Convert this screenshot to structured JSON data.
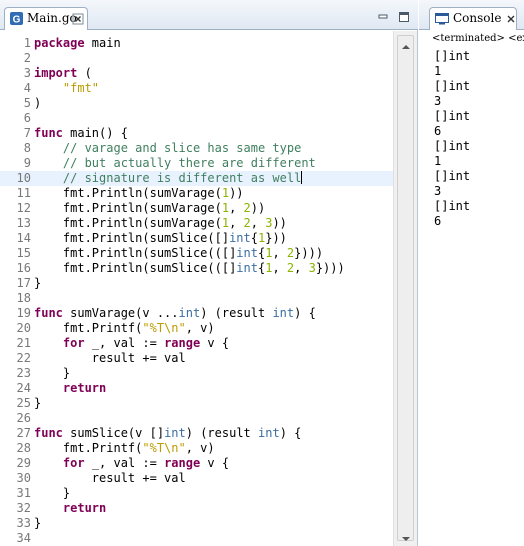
{
  "editor": {
    "tab_label": "Main.go",
    "lines": [
      {
        "n": "1",
        "tokens": [
          {
            "t": "kw",
            "v": "package"
          },
          {
            "t": "",
            "v": " main"
          }
        ]
      },
      {
        "n": "2",
        "tokens": []
      },
      {
        "n": "3",
        "tokens": [
          {
            "t": "kw",
            "v": "import"
          },
          {
            "t": "",
            "v": " ("
          }
        ]
      },
      {
        "n": "4",
        "tokens": [
          {
            "t": "",
            "v": "    "
          },
          {
            "t": "str",
            "v": "\"fmt\""
          }
        ]
      },
      {
        "n": "5",
        "tokens": [
          {
            "t": "",
            "v": ")"
          }
        ]
      },
      {
        "n": "6",
        "tokens": []
      },
      {
        "n": "7",
        "tokens": [
          {
            "t": "kw",
            "v": "func"
          },
          {
            "t": "",
            "v": " main() {"
          }
        ]
      },
      {
        "n": "8",
        "tokens": [
          {
            "t": "",
            "v": "    "
          },
          {
            "t": "cm",
            "v": "// varage and slice has same type"
          }
        ]
      },
      {
        "n": "9",
        "tokens": [
          {
            "t": "",
            "v": "    "
          },
          {
            "t": "cm",
            "v": "// but actually there are different"
          }
        ]
      },
      {
        "n": "10",
        "current": true,
        "tokens": [
          {
            "t": "",
            "v": "    "
          },
          {
            "t": "cm",
            "v": "// signature is different as well"
          },
          {
            "t": "caret",
            "v": ""
          }
        ]
      },
      {
        "n": "11",
        "tokens": [
          {
            "t": "",
            "v": "    fmt.Println(sumVarage("
          },
          {
            "t": "num",
            "v": "1"
          },
          {
            "t": "",
            "v": "))"
          }
        ]
      },
      {
        "n": "12",
        "tokens": [
          {
            "t": "",
            "v": "    fmt.Println(sumVarage("
          },
          {
            "t": "num",
            "v": "1"
          },
          {
            "t": "",
            "v": ", "
          },
          {
            "t": "num",
            "v": "2"
          },
          {
            "t": "",
            "v": "))"
          }
        ]
      },
      {
        "n": "13",
        "tokens": [
          {
            "t": "",
            "v": "    fmt.Println(sumVarage("
          },
          {
            "t": "num",
            "v": "1"
          },
          {
            "t": "",
            "v": ", "
          },
          {
            "t": "num",
            "v": "2"
          },
          {
            "t": "",
            "v": ", "
          },
          {
            "t": "num",
            "v": "3"
          },
          {
            "t": "",
            "v": "))"
          }
        ]
      },
      {
        "n": "14",
        "tokens": [
          {
            "t": "",
            "v": "    fmt.Println(sumSlice([]"
          },
          {
            "t": "ty",
            "v": "int"
          },
          {
            "t": "",
            "v": "{"
          },
          {
            "t": "num",
            "v": "1"
          },
          {
            "t": "",
            "v": "}))"
          }
        ]
      },
      {
        "n": "15",
        "tokens": [
          {
            "t": "",
            "v": "    fmt.Println(sumSlice(([]"
          },
          {
            "t": "ty",
            "v": "int"
          },
          {
            "t": "",
            "v": "{"
          },
          {
            "t": "num",
            "v": "1"
          },
          {
            "t": "",
            "v": ", "
          },
          {
            "t": "num",
            "v": "2"
          },
          {
            "t": "",
            "v": "})))"
          }
        ]
      },
      {
        "n": "16",
        "tokens": [
          {
            "t": "",
            "v": "    fmt.Println(sumSlice(([]"
          },
          {
            "t": "ty",
            "v": "int"
          },
          {
            "t": "",
            "v": "{"
          },
          {
            "t": "num",
            "v": "1"
          },
          {
            "t": "",
            "v": ", "
          },
          {
            "t": "num",
            "v": "2"
          },
          {
            "t": "",
            "v": ", "
          },
          {
            "t": "num",
            "v": "3"
          },
          {
            "t": "",
            "v": "})))"
          }
        ]
      },
      {
        "n": "17",
        "tokens": [
          {
            "t": "",
            "v": "}"
          }
        ]
      },
      {
        "n": "18",
        "tokens": []
      },
      {
        "n": "19",
        "tokens": [
          {
            "t": "kw",
            "v": "func"
          },
          {
            "t": "",
            "v": " sumVarage(v ..."
          },
          {
            "t": "ty",
            "v": "int"
          },
          {
            "t": "",
            "v": ") (result "
          },
          {
            "t": "ty",
            "v": "int"
          },
          {
            "t": "",
            "v": ") {"
          }
        ]
      },
      {
        "n": "20",
        "tokens": [
          {
            "t": "",
            "v": "    fmt.Printf("
          },
          {
            "t": "str",
            "v": "\"%T\\n\""
          },
          {
            "t": "",
            "v": ", v)"
          }
        ]
      },
      {
        "n": "21",
        "tokens": [
          {
            "t": "",
            "v": "    "
          },
          {
            "t": "kw",
            "v": "for"
          },
          {
            "t": "",
            "v": " _, val := "
          },
          {
            "t": "kw",
            "v": "range"
          },
          {
            "t": "",
            "v": " v {"
          }
        ]
      },
      {
        "n": "22",
        "tokens": [
          {
            "t": "",
            "v": "        result += val"
          }
        ]
      },
      {
        "n": "23",
        "tokens": [
          {
            "t": "",
            "v": "    }"
          }
        ]
      },
      {
        "n": "24",
        "tokens": [
          {
            "t": "",
            "v": "    "
          },
          {
            "t": "kw",
            "v": "return"
          }
        ]
      },
      {
        "n": "25",
        "tokens": [
          {
            "t": "",
            "v": "}"
          }
        ]
      },
      {
        "n": "26",
        "tokens": []
      },
      {
        "n": "27",
        "tokens": [
          {
            "t": "kw",
            "v": "func"
          },
          {
            "t": "",
            "v": " sumSlice(v []"
          },
          {
            "t": "ty",
            "v": "int"
          },
          {
            "t": "",
            "v": ") (result "
          },
          {
            "t": "ty",
            "v": "int"
          },
          {
            "t": "",
            "v": ") {"
          }
        ]
      },
      {
        "n": "28",
        "tokens": [
          {
            "t": "",
            "v": "    fmt.Printf("
          },
          {
            "t": "str",
            "v": "\"%T\\n\""
          },
          {
            "t": "",
            "v": ", v)"
          }
        ]
      },
      {
        "n": "29",
        "tokens": [
          {
            "t": "",
            "v": "    "
          },
          {
            "t": "kw",
            "v": "for"
          },
          {
            "t": "",
            "v": " _, val := "
          },
          {
            "t": "kw",
            "v": "range"
          },
          {
            "t": "",
            "v": " v {"
          }
        ]
      },
      {
        "n": "30",
        "tokens": [
          {
            "t": "",
            "v": "        result += val"
          }
        ]
      },
      {
        "n": "31",
        "tokens": [
          {
            "t": "",
            "v": "    }"
          }
        ]
      },
      {
        "n": "32",
        "tokens": [
          {
            "t": "",
            "v": "    "
          },
          {
            "t": "kw",
            "v": "return"
          }
        ]
      },
      {
        "n": "33",
        "tokens": [
          {
            "t": "",
            "v": "}"
          }
        ]
      },
      {
        "n": "34",
        "tokens": []
      }
    ]
  },
  "console": {
    "tab_label": "Console",
    "status": "<terminated> <exit c",
    "output": [
      "[]int",
      "1",
      "[]int",
      "3",
      "[]int",
      "6",
      "[]int",
      "1",
      "[]int",
      "3",
      "[]int",
      "6"
    ]
  },
  "icons": {
    "go_file": "go-file-icon",
    "close": "close-icon",
    "minimize": "minimize-icon",
    "maximize": "maximize-icon",
    "console": "console-icon",
    "scroll_up": "scroll-up-arrow-icon",
    "scroll_down": "scroll-down-arrow-icon"
  },
  "colors": {
    "keyword": "#7f0055",
    "comment": "#3f7f5f",
    "string": "#bc9b00",
    "number": "#8bb300",
    "type": "#3a6ea5",
    "current_line": "#e8f2fe"
  }
}
